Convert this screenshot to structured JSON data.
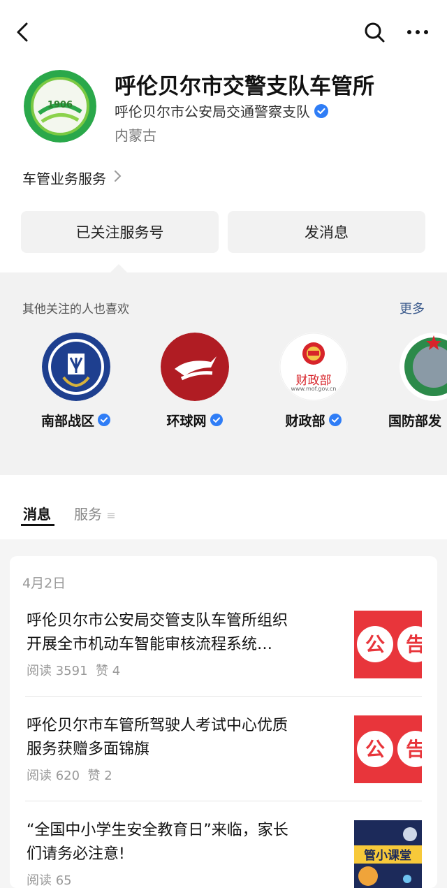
{
  "account": {
    "name": "呼伦贝尔市交警支队车管所",
    "organization": "呼伦贝尔市公安局交通警察支队",
    "region": "内蒙古",
    "service_link": "车管业务服务"
  },
  "buttons": {
    "follow": "已关注服务号",
    "message": "发消息"
  },
  "recommendations": {
    "title": "其他关注的人也喜欢",
    "more": "更多",
    "items": [
      {
        "label": "南部战区",
        "icon": "southern-theater-emblem"
      },
      {
        "label": "环球网",
        "icon": "huanqiu-logo"
      },
      {
        "label": "财政部",
        "icon": "ministry-of-finance-emblem",
        "avatar_text": "财政部",
        "avatar_sub": "www.mof.gov.cn"
      },
      {
        "label": "国防部发",
        "icon": "defense-ministry-emblem"
      }
    ]
  },
  "tabs": {
    "messages": "消息",
    "services": "服务"
  },
  "feed": {
    "date": "4月2日",
    "articles": [
      {
        "title_line1": "呼伦贝尔市公安局交管支队车管所组织",
        "title_line2": "开展全市机动车智能审核流程系统…",
        "reads": "阅读 3591",
        "likes": "赞 4",
        "thumb_text": "公告"
      },
      {
        "title_line1": "呼伦贝尔市车管所驾驶人考试中心优质",
        "title_line2": "服务获赠多面锦旗",
        "reads": "阅读 620",
        "likes": "赞 2",
        "thumb_text": "公告"
      },
      {
        "title_line1": "“全国中小学生安全教育日”来临，家长",
        "title_line2": "们请务必注意!",
        "reads": "阅读 65",
        "likes": "",
        "thumb_text": "管小课堂"
      }
    ]
  },
  "colors": {
    "verified": "#2f7df6",
    "link": "#3b5a8c",
    "notice_red": "#e8353b"
  }
}
